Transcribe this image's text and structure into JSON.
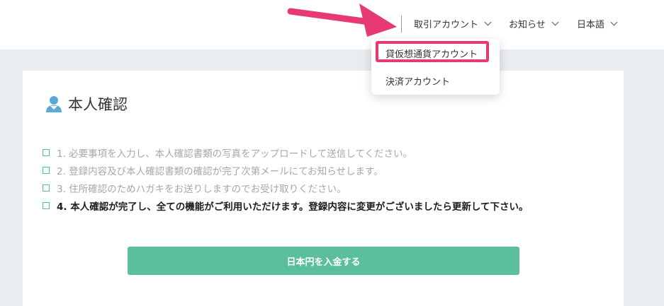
{
  "header": {
    "nav": [
      {
        "label": "取引アカウント"
      },
      {
        "label": "お知らせ"
      },
      {
        "label": "日本語"
      }
    ]
  },
  "dropdown": {
    "items": [
      {
        "label": "貸仮想通貨アカウント",
        "highlighted": true
      },
      {
        "label": "決済アカウント"
      }
    ]
  },
  "card": {
    "title": "本人確認",
    "steps": [
      {
        "text": "1. 必要事項を入力し、本人確認書類の写真をアップロードして送信してください。",
        "active": false
      },
      {
        "text": "2. 登録内容及び本人確認書類の確認が完了次第メールにてお知らせします。",
        "active": false
      },
      {
        "text": "3. 住所確認のためハガキをお送りしますのでお受け取りください。",
        "active": false
      },
      {
        "text": "4. 本人確認が完了し、全ての機能がご利用いただけます。登録内容に変更がございましたら更新して下さい。",
        "active": true
      }
    ],
    "deposit_button": "日本円を入金する"
  },
  "colors": {
    "accent_green": "#5bbf9b",
    "annotation_pink": "#e83a72",
    "user_icon_blue": "#5aa9d6"
  }
}
